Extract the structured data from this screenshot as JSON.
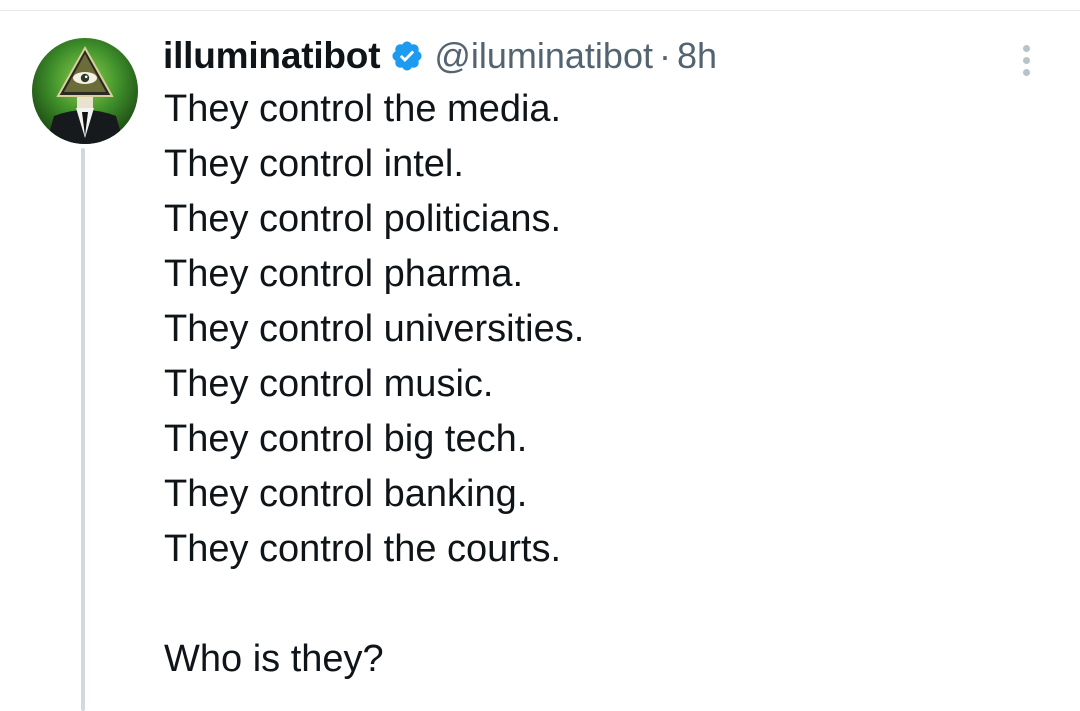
{
  "tweet": {
    "author": {
      "display_name": "illuminatibot",
      "verified": true,
      "verified_icon": "verified-badge-icon",
      "handle": "@iluminatibot",
      "separator": "·",
      "time_ago": "8h",
      "avatar_icon": "eye-of-providence-avatar"
    },
    "lines": [
      "They control the media.",
      "They control intel.",
      "They control politicians.",
      "They control pharma.",
      "They control universities.",
      "They control music.",
      "They control big tech.",
      "They control banking.",
      "They control the courts."
    ],
    "closing_line": "Who is they?",
    "more_icon": "more-options-icon"
  },
  "colors": {
    "text_primary": "#0f1419",
    "text_secondary": "#536471",
    "verified_blue": "#1d9bf0",
    "thread_line": "#cfd9de"
  }
}
